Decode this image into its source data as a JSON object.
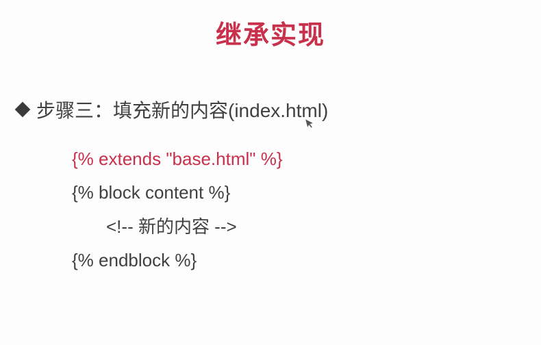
{
  "title": "继承实现",
  "step": {
    "label": "步骤三：填充新的内容(index.html)"
  },
  "code": {
    "lines": [
      {
        "text": "{% extends \"base.html\" %}",
        "highlight": true,
        "indent": false
      },
      {
        "text": "{% block content %}",
        "highlight": false,
        "indent": false
      },
      {
        "text": "<!-- 新的内容 -->",
        "highlight": false,
        "indent": true
      },
      {
        "text": "{% endblock %}",
        "highlight": false,
        "indent": false
      }
    ]
  }
}
